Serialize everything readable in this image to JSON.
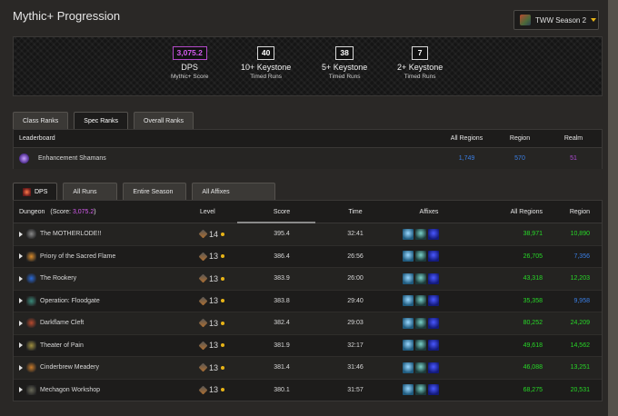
{
  "header": {
    "title": "Mythic+ Progression",
    "season_label": "TWW Season 2"
  },
  "score_panel": {
    "stats": [
      {
        "value": "3,075.2",
        "label": "DPS",
        "sublabel": "Mythic+ Score"
      },
      {
        "value": "40",
        "label": "10+ Keystone",
        "sublabel": "Timed Runs"
      },
      {
        "value": "38",
        "label": "5+ Keystone",
        "sublabel": "Timed Runs"
      },
      {
        "value": "7",
        "label": "2+ Keystone",
        "sublabel": "Timed Runs"
      }
    ]
  },
  "rank_tabs": [
    "Class Ranks",
    "Spec Ranks",
    "Overall Ranks"
  ],
  "leaderboard": {
    "headers": {
      "name": "Leaderboard",
      "all_regions": "All Regions",
      "region": "Region",
      "realm": "Realm"
    },
    "row": {
      "name": "Enhancement Shamans",
      "all_regions": "1,749",
      "region": "570",
      "realm": "51"
    }
  },
  "run_tabs": [
    "DPS",
    "All Runs",
    "Entire Season",
    "All Affixes"
  ],
  "dungeon_table": {
    "headers": {
      "dungeon": "Dungeon",
      "score_prefix": "(Score: ",
      "score_value": "3,075.2",
      "score_suffix": ")",
      "level": "Level",
      "score": "Score",
      "time": "Time",
      "affixes": "Affixes",
      "all_regions": "All Regions",
      "region": "Region"
    },
    "rows": [
      {
        "name": "The MOTHERLODE!!",
        "level": "14",
        "score": "395.4",
        "time": "32:41",
        "all_regions": "38,971",
        "region": "10,890",
        "region_color": "green"
      },
      {
        "name": "Priory of the Sacred Flame",
        "level": "13",
        "score": "386.4",
        "time": "26:56",
        "all_regions": "26,705",
        "region": "7,356",
        "region_color": "blue"
      },
      {
        "name": "The Rookery",
        "level": "13",
        "score": "383.9",
        "time": "26:00",
        "all_regions": "43,318",
        "region": "12,203",
        "region_color": "green"
      },
      {
        "name": "Operation: Floodgate",
        "level": "13",
        "score": "383.8",
        "time": "29:40",
        "all_regions": "35,358",
        "region": "9,958",
        "region_color": "blue"
      },
      {
        "name": "Darkflame Cleft",
        "level": "13",
        "score": "382.4",
        "time": "29:03",
        "all_regions": "80,252",
        "region": "24,209",
        "region_color": "green"
      },
      {
        "name": "Theater of Pain",
        "level": "13",
        "score": "381.9",
        "time": "32:17",
        "all_regions": "49,618",
        "region": "14,562",
        "region_color": "green"
      },
      {
        "name": "Cinderbrew Meadery",
        "level": "13",
        "score": "381.4",
        "time": "31:46",
        "all_regions": "46,088",
        "region": "13,251",
        "region_color": "green"
      },
      {
        "name": "Mechagon Workshop",
        "level": "13",
        "score": "380.1",
        "time": "31:57",
        "all_regions": "68,275",
        "region": "20,531",
        "region_color": "green"
      }
    ]
  },
  "colors": {
    "score_magenta": "#d65cf0",
    "rank_green": "#27d827",
    "rank_blue": "#3a7fe6",
    "rank_purple": "#b049d6",
    "key_dot": "#e8b417"
  }
}
